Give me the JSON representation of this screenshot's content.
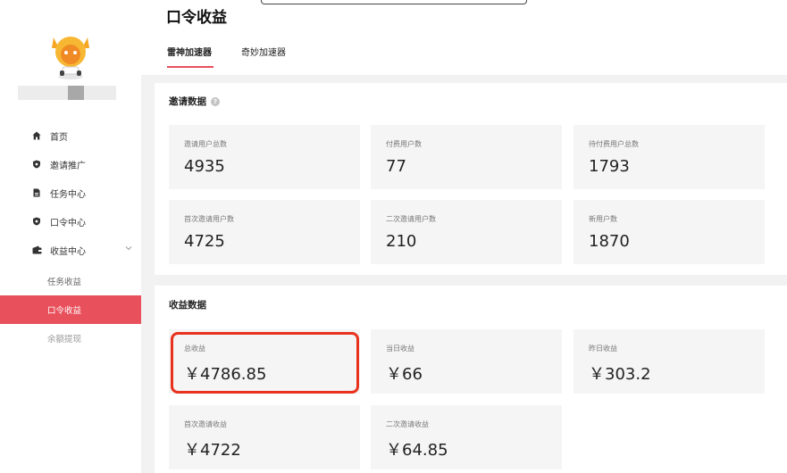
{
  "page": {
    "title": "口令收益"
  },
  "tabs": [
    {
      "label": "雷神加速器",
      "active": true
    },
    {
      "label": "奇妙加速器",
      "active": false
    }
  ],
  "sidebar": {
    "items": [
      {
        "label": "首页",
        "icon": "home-icon"
      },
      {
        "label": "邀请推广",
        "icon": "shield-icon"
      },
      {
        "label": "任务中心",
        "icon": "document-icon"
      },
      {
        "label": "口令中心",
        "icon": "shield-icon"
      },
      {
        "label": "收益中心",
        "icon": "wallet-icon",
        "expanded": true
      }
    ],
    "sub_items": [
      {
        "label": "任务收益",
        "active": false
      },
      {
        "label": "口令收益",
        "active": true
      },
      {
        "label": "余额提现",
        "active": false
      }
    ]
  },
  "invite": {
    "title": "邀请数据",
    "stats": [
      {
        "label": "邀请用户总数",
        "value": "4935"
      },
      {
        "label": "付费用户数",
        "value": "77"
      },
      {
        "label": "待付费用户总数",
        "value": "1793"
      },
      {
        "label": "首次邀请用户数",
        "value": "4725"
      },
      {
        "label": "二次邀请用户数",
        "value": "210"
      },
      {
        "label": "新用户数",
        "value": "1870"
      }
    ]
  },
  "earnings": {
    "title": "收益数据",
    "stats": [
      {
        "label": "总收益",
        "value": "￥4786.85"
      },
      {
        "label": "当日收益",
        "value": "￥66"
      },
      {
        "label": "昨日收益",
        "value": "￥303.2"
      },
      {
        "label": "首次邀请收益",
        "value": "￥4722"
      },
      {
        "label": "二次邀请收益",
        "value": "￥64.85"
      }
    ]
  },
  "colors": {
    "accent": "#e8505b",
    "highlight": "#e8321e"
  }
}
